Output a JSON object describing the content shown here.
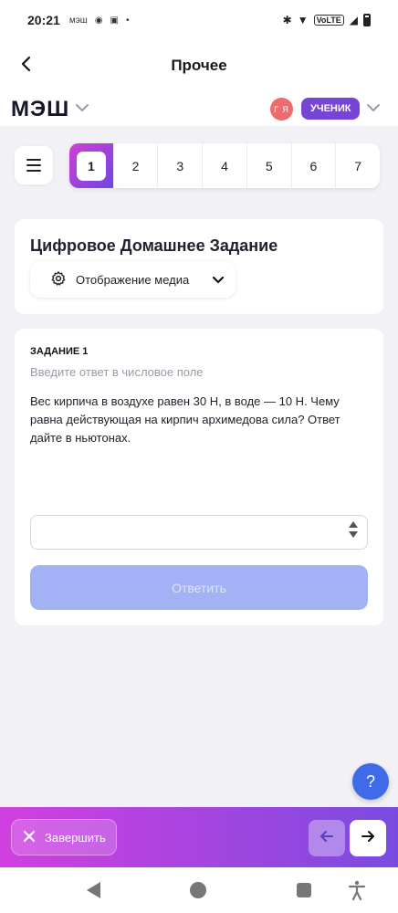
{
  "status_bar": {
    "time": "20:21",
    "carrier_text": "мэш",
    "lte_label": "VoLTE"
  },
  "app_bar": {
    "title": "Прочее"
  },
  "mesh_header": {
    "logo": "МЭШ",
    "avatar_initials": "Г Я",
    "role": "УЧЕНИК"
  },
  "task_tabs": {
    "items": [
      "1",
      "2",
      "3",
      "4",
      "5",
      "6",
      "7"
    ],
    "active": "1"
  },
  "homework": {
    "title": "Цифровое Домашнее Задание",
    "media_label": "Отображение медиа"
  },
  "task": {
    "number_label": "ЗАДАНИЕ 1",
    "hint": "Введите ответ в числовое поле",
    "question": "Вес кирпича в воздухе равен 30 Н, в воде — 10 Н. Чему равна действующая на кирпич архимедова сила? Ответ дайте в ньютонах.",
    "answer_value": "",
    "submit_label": "Ответить"
  },
  "help": {
    "label": "?"
  },
  "bottom_bar": {
    "finish_label": "Завершить"
  },
  "colors": {
    "accent_purple": "#7745d6",
    "gradient_start": "#d23fe0",
    "gradient_end": "#7a4be0",
    "help_blue": "#3f6ae8",
    "submit_disabled": "#a3b2f4"
  }
}
